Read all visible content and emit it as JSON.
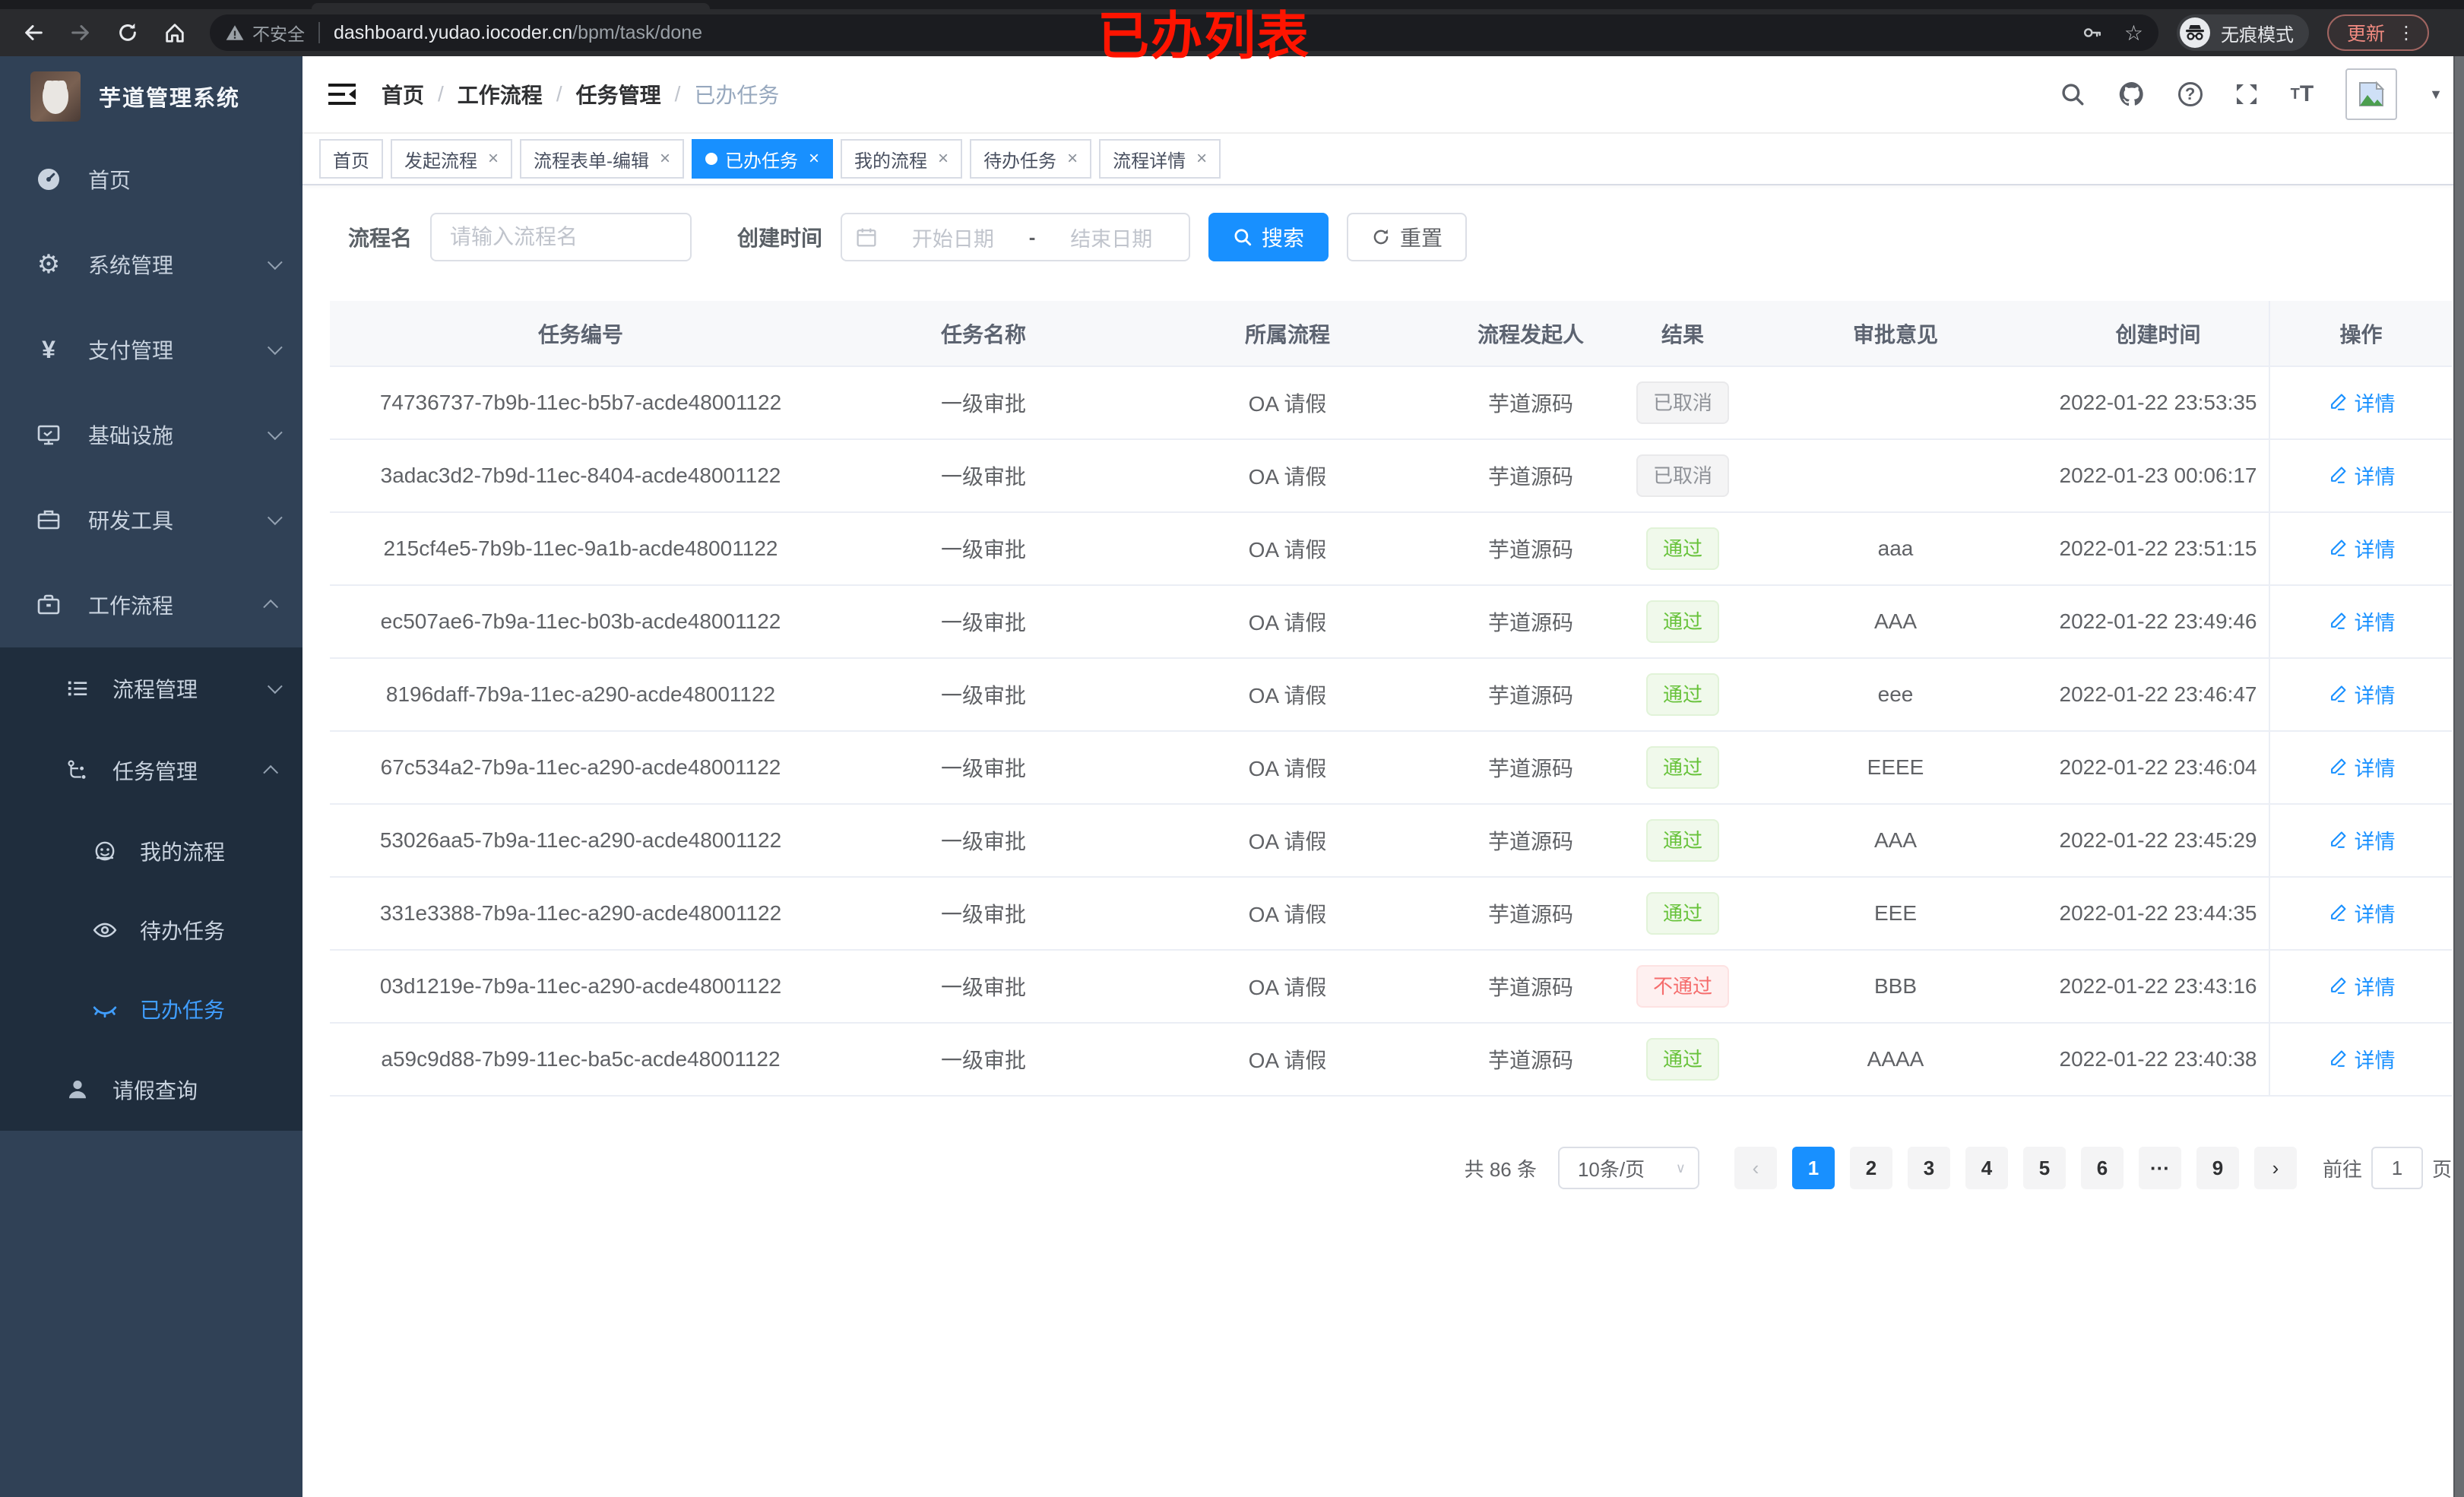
{
  "annotation": {
    "text": "已办列表"
  },
  "browser": {
    "security_label": "不安全",
    "url_host": "dashboard.yudao.iocoder.cn",
    "url_path": "/bpm/task/done",
    "incognito_label": "无痕模式",
    "update_label": "更新"
  },
  "sidebar": {
    "title": "芋道管理系统",
    "menu": [
      {
        "label": "首页",
        "icon": "dashboard-icon"
      },
      {
        "label": "系统管理",
        "icon": "gear-icon",
        "arrow": "down"
      },
      {
        "label": "支付管理",
        "icon": "yen-icon",
        "arrow": "down"
      },
      {
        "label": "基础设施",
        "icon": "monitor-icon",
        "arrow": "down"
      },
      {
        "label": "研发工具",
        "icon": "toolbox-icon",
        "arrow": "down"
      },
      {
        "label": "工作流程",
        "icon": "briefcase-icon",
        "arrow": "up"
      }
    ],
    "submenu": [
      {
        "label": "流程管理",
        "icon": "list-icon",
        "arrow": "down"
      },
      {
        "label": "任务管理",
        "icon": "flow-icon",
        "arrow": "up"
      }
    ],
    "task_children": [
      {
        "label": "我的流程",
        "icon": "face-icon",
        "active": false
      },
      {
        "label": "待办任务",
        "icon": "eye-icon",
        "active": false
      },
      {
        "label": "已办任务",
        "icon": "eye-closed-icon",
        "active": true
      }
    ],
    "leave_item": {
      "label": "请假查询",
      "icon": "user-icon"
    }
  },
  "header": {
    "breadcrumb": [
      "首页",
      "工作流程",
      "任务管理",
      "已办任务"
    ]
  },
  "tabs": [
    {
      "label": "首页",
      "closable": false,
      "active": false
    },
    {
      "label": "发起流程",
      "closable": true,
      "active": false
    },
    {
      "label": "流程表单-编辑",
      "closable": true,
      "active": false
    },
    {
      "label": "已办任务",
      "closable": true,
      "active": true
    },
    {
      "label": "我的流程",
      "closable": true,
      "active": false
    },
    {
      "label": "待办任务",
      "closable": true,
      "active": false
    },
    {
      "label": "流程详情",
      "closable": true,
      "active": false
    }
  ],
  "filters": {
    "name_label": "流程名",
    "name_placeholder": "请输入流程名",
    "time_label": "创建时间",
    "start_placeholder": "开始日期",
    "range_separator": "-",
    "end_placeholder": "结束日期",
    "search_label": "搜索",
    "reset_label": "重置"
  },
  "table": {
    "columns": [
      "任务编号",
      "任务名称",
      "所属流程",
      "流程发起人",
      "结果",
      "审批意见",
      "创建时间",
      "操作"
    ],
    "rows": [
      {
        "id": "74736737-7b9b-11ec-b5b7-acde48001122",
        "name": "一级审批",
        "process": "OA 请假",
        "starter": "芋道源码",
        "result": "已取消",
        "result_type": "info",
        "opinion": "",
        "created": "2022-01-22 23:53:35",
        "action": "详情"
      },
      {
        "id": "3adac3d2-7b9d-11ec-8404-acde48001122",
        "name": "一级审批",
        "process": "OA 请假",
        "starter": "芋道源码",
        "result": "已取消",
        "result_type": "info",
        "opinion": "",
        "created": "2022-01-23 00:06:17",
        "action": "详情"
      },
      {
        "id": "215cf4e5-7b9b-11ec-9a1b-acde48001122",
        "name": "一级审批",
        "process": "OA 请假",
        "starter": "芋道源码",
        "result": "通过",
        "result_type": "success",
        "opinion": "aaa",
        "created": "2022-01-22 23:51:15",
        "action": "详情"
      },
      {
        "id": "ec507ae6-7b9a-11ec-b03b-acde48001122",
        "name": "一级审批",
        "process": "OA 请假",
        "starter": "芋道源码",
        "result": "通过",
        "result_type": "success",
        "opinion": "AAA",
        "created": "2022-01-22 23:49:46",
        "action": "详情"
      },
      {
        "id": "8196daff-7b9a-11ec-a290-acde48001122",
        "name": "一级审批",
        "process": "OA 请假",
        "starter": "芋道源码",
        "result": "通过",
        "result_type": "success",
        "opinion": "eee",
        "created": "2022-01-22 23:46:47",
        "action": "详情"
      },
      {
        "id": "67c534a2-7b9a-11ec-a290-acde48001122",
        "name": "一级审批",
        "process": "OA 请假",
        "starter": "芋道源码",
        "result": "通过",
        "result_type": "success",
        "opinion": "EEEE",
        "created": "2022-01-22 23:46:04",
        "action": "详情"
      },
      {
        "id": "53026aa5-7b9a-11ec-a290-acde48001122",
        "name": "一级审批",
        "process": "OA 请假",
        "starter": "芋道源码",
        "result": "通过",
        "result_type": "success",
        "opinion": "AAA",
        "created": "2022-01-22 23:45:29",
        "action": "详情"
      },
      {
        "id": "331e3388-7b9a-11ec-a290-acde48001122",
        "name": "一级审批",
        "process": "OA 请假",
        "starter": "芋道源码",
        "result": "通过",
        "result_type": "success",
        "opinion": "EEE",
        "created": "2022-01-22 23:44:35",
        "action": "详情"
      },
      {
        "id": "03d1219e-7b9a-11ec-a290-acde48001122",
        "name": "一级审批",
        "process": "OA 请假",
        "starter": "芋道源码",
        "result": "不通过",
        "result_type": "danger",
        "opinion": "BBB",
        "created": "2022-01-22 23:43:16",
        "action": "详情"
      },
      {
        "id": "a59c9d88-7b99-11ec-ba5c-acde48001122",
        "name": "一级审批",
        "process": "OA 请假",
        "starter": "芋道源码",
        "result": "通过",
        "result_type": "success",
        "opinion": "AAAA",
        "created": "2022-01-22 23:40:38",
        "action": "详情"
      }
    ]
  },
  "pagination": {
    "total_label": "共 86 条",
    "page_size": "10条/页",
    "pages": [
      "1",
      "2",
      "3",
      "4",
      "5",
      "6",
      "···",
      "9"
    ],
    "active_page": "1",
    "goto_label": "前往",
    "goto_value": "1",
    "page_label": "页"
  },
  "colors": {
    "accent": "#1890ff",
    "success": "#67c23a",
    "danger": "#f56c6c",
    "info": "#909399",
    "sidebar": "#304156",
    "submenu": "#1f2d3d"
  }
}
